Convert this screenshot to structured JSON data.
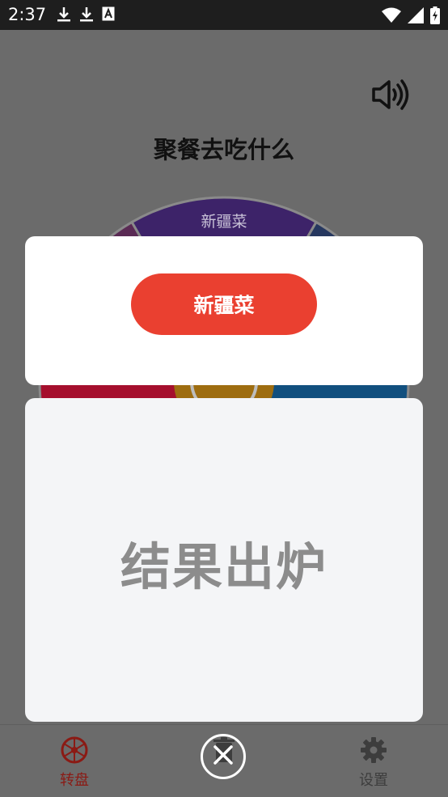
{
  "status_bar": {
    "time": "2:37",
    "icons": [
      "download-icon",
      "download-icon",
      "text-a-icon",
      "wifi-icon",
      "signal-icon",
      "battery-charging-icon"
    ]
  },
  "header": {
    "title": "聚餐去吃什么",
    "sound_icon": "speaker-icon"
  },
  "wheel": {
    "top_segment_label": "新疆菜",
    "segment_colors": [
      "#3d2369",
      "#26375f",
      "#114f7e",
      "#9e6d10",
      "#a50f2d",
      "#5a2a54"
    ]
  },
  "result_dialog": {
    "result": "新疆菜"
  },
  "announcement": {
    "text": "结果出炉"
  },
  "bottom_nav": {
    "items": [
      {
        "label": "转盘",
        "icon": "wheel-icon",
        "active": true
      },
      {
        "label": "",
        "icon": "delete-icon",
        "active": false
      },
      {
        "label": "设置",
        "icon": "gear-icon",
        "active": false
      }
    ]
  },
  "colors": {
    "accent": "#ea4030",
    "active_nav": "#8b1a14",
    "inactive_nav": "#3d3d3d"
  }
}
